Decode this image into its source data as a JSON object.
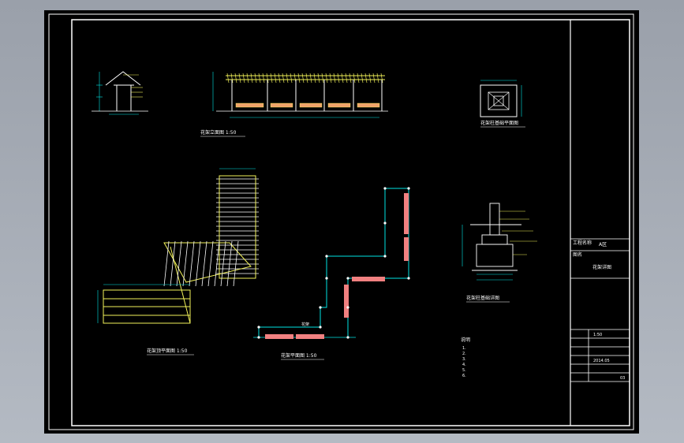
{
  "drawing": {
    "background": "#000000",
    "line_color": "#ffffff",
    "dim_color": "#00e5e5",
    "member_color": "#f2f25a",
    "fill_color": "#f08080"
  },
  "views": {
    "elevation_title": "花架立面图 1:50",
    "column_plan_title": "花架柱基础平面图",
    "top_plan_title": "花架顶平面图 1:50",
    "base_plan_title": "花架平面图 1:50",
    "foundation_title": "花架柱基础详图",
    "base_plan_label": "花架"
  },
  "notes": {
    "heading": "说明",
    "items": [
      "1.",
      "2.",
      "3.",
      "4.",
      "5.",
      "6."
    ]
  },
  "title_block": {
    "project_label": "工程名称",
    "project_value": "A区",
    "drawing_label": "图名",
    "drawing_value": "花架详图",
    "scale_row": "1:50",
    "date_row": "2014.05",
    "sheet_row": "03"
  }
}
